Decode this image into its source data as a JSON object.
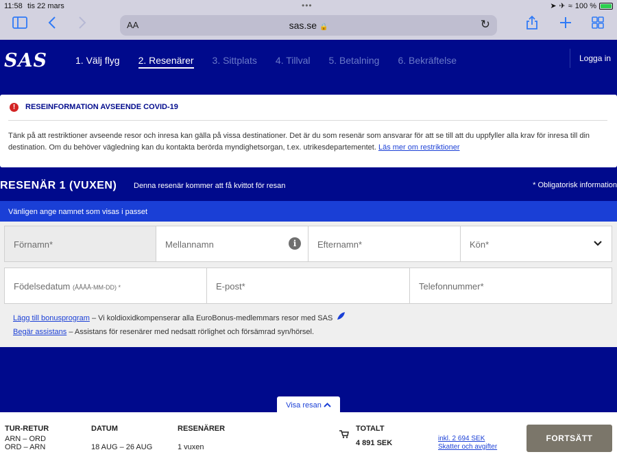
{
  "status_bar": {
    "time": "11:58",
    "date": "tis 22 mars",
    "battery": "100 %",
    "battery_level": 1.0,
    "battery_color": "#2bd04e"
  },
  "browser": {
    "text_size_label": "AA",
    "domain": "sas.se"
  },
  "header": {
    "logo": "SAS",
    "steps": [
      {
        "label": "1. Välj flyg",
        "state": "done"
      },
      {
        "label": "2. Resenärer",
        "state": "active"
      },
      {
        "label": "3. Sittplats",
        "state": "upcoming"
      },
      {
        "label": "4. Tillval",
        "state": "upcoming"
      },
      {
        "label": "5. Betalning",
        "state": "upcoming"
      },
      {
        "label": "6. Bekräftelse",
        "state": "upcoming"
      }
    ],
    "login": "Logga in"
  },
  "covid_notice": {
    "title": "RESEINFORMATION AVSEENDE COVID-19",
    "body": "Tänk på att restriktioner avseende resor och inresa kan gälla på vissa destinationer. Det är du som resenär som ansvarar för att se till att du uppfyller alla krav för inresa till din destination. Om du behöver vägledning kan du kontakta berörda myndighetsorgan, t.ex. utrikesdepartementet.",
    "link": "Läs mer om restriktioner"
  },
  "passenger": {
    "title": "RESENÄR 1 (VUXEN)",
    "subtitle": "Denna resenär kommer att få kvittot för resan",
    "required_note": "* Obligatorisk information",
    "name_hint": "Vänligen ange namnet som visas i passet",
    "fields": {
      "first_name": "Förnamn*",
      "middle_name": "Mellannamn",
      "last_name": "Efternamn*",
      "gender": "Kön*",
      "birth_date": "Födelsedatum",
      "birth_date_format": "(ÅÅÅÅ-MM-DD) *",
      "email": "E-post*",
      "phone": "Telefonnummer*"
    },
    "bonus_link": "Lägg till bonusprogram",
    "bonus_text": "– Vi koldioxidkompenserar alla EuroBonus-medlemmars resor med SAS",
    "assist_link": "Begär assistans",
    "assist_text": "– Assistans för resenärer med nedsatt rörlighet och försämrad syn/hörsel."
  },
  "trip_toggle": "Visa resan",
  "footer": {
    "trip_type_label": "TUR-RETUR",
    "routes": [
      "ARN – ORD",
      "ORD – ARN"
    ],
    "date_label": "DATUM",
    "dates": "18 AUG – 26 AUG",
    "passengers_label": "RESENÄRER",
    "passengers": "1 vuxen",
    "total_label": "TOTALT",
    "total": "4 891 SEK",
    "tax_included": "inkl. 2 694 SEK",
    "tax_link": "Skatter och avgifter",
    "continue_label": "FORTSÄTT"
  },
  "colors": {
    "brand_blue": "#000a8c",
    "accent_blue": "#1a3fd6",
    "continue_button": "#7b766a",
    "warning_red": "#d32323"
  },
  "icons": [
    "sidebar-icon",
    "back-icon",
    "forward-icon",
    "lock-icon",
    "reload-icon",
    "share-icon",
    "new-tab-icon",
    "tabs-icon",
    "warning-icon",
    "info-icon",
    "chevron-down-icon",
    "leaf-icon",
    "chevron-up-icon",
    "cart-icon"
  ]
}
